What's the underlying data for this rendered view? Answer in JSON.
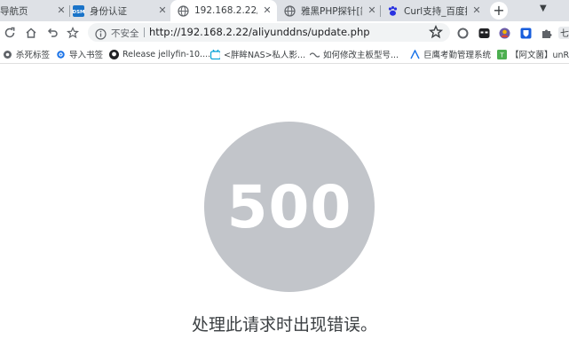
{
  "tabs": [
    {
      "label": "导航页",
      "icon": "none"
    },
    {
      "label": "身份认证",
      "icon": "dsm-icon"
    },
    {
      "label": "192.168.2.22/aliy",
      "icon": "globe-icon",
      "active": true
    },
    {
      "label": "雅黑PHP探针[简",
      "icon": "globe-icon"
    },
    {
      "label": "Curl支持_百度搜",
      "icon": "baidu-paw-icon"
    }
  ],
  "toolbar": {
    "security_label": "不安全",
    "url": "http://192.168.2.22/aliyunddns/update.php"
  },
  "bookmarks": [
    {
      "label": "杀死标签",
      "icon": "settings-icon"
    },
    {
      "label": "导入书签",
      "icon": "gear-icon"
    },
    {
      "label": "Release jellyfin-10....",
      "icon": "github-icon"
    },
    {
      "label": "<胖眸NAS>私人影...",
      "icon": "bilibili-icon"
    },
    {
      "label": "如何修改主板型号...",
      "icon": "wave-icon"
    },
    {
      "label": "巨鹰考勤管理系统",
      "icon": "triangle-icon"
    },
    {
      "label": "【阿文菌】unRA",
      "icon": "green-square-icon"
    }
  ],
  "page": {
    "error_code": "500",
    "error_message": "处理此请求时出现错误。"
  },
  "colors": {
    "tabstrip_bg": "#dee1e6",
    "omnibox_bg": "#f1f3f4",
    "circle": "#c2c5ca",
    "text": "#3c4043"
  }
}
